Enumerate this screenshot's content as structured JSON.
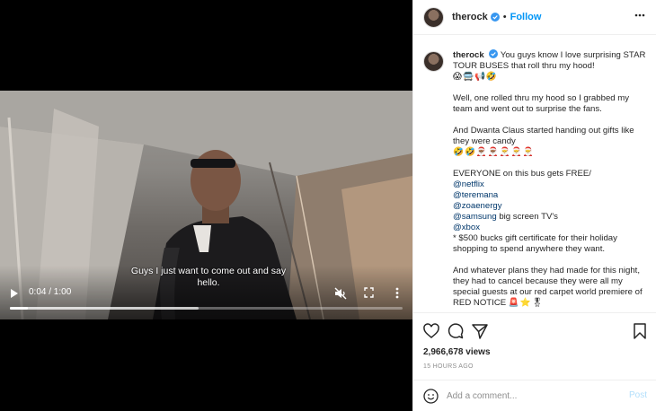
{
  "video": {
    "subtitle": "Guys I just want to come out and say hello.",
    "time": "0:04 / 1:00",
    "progress_played": 0.046,
    "progress_buffered": 0.48
  },
  "header": {
    "username": "therock",
    "separator": "•",
    "follow_label": "Follow"
  },
  "caption": {
    "username": "therock",
    "intro": "You guys know I love surprising STAR TOUR BUSES that roll thru my hood!",
    "intro_emojis": "😱🚍📢🤣",
    "p2": "Well, one rolled thru my hood so I grabbed my team and went out to surprise the fans.",
    "p3": "And Dwanta Claus started handing out gifts like they were candy",
    "p3_emojis": "🤣🤣🎅🏾🎅🏾🎅🎅🎅",
    "p4_lead": "EVERYONE on this bus gets FREE/",
    "mention_1": "@netflix",
    "mention_2": "@teremana",
    "mention_3": "@zoaenergy",
    "mention_4": "@samsung",
    "mention_4_text": " big screen TV's",
    "mention_5": "@xbox",
    "gift_line": "* $500 bucks gift certificate for their holiday shopping to spend anywhere they want.",
    "p5": "And whatever plans they had made for this night, they had to cancel because they were all my special guests at our red carpet world premiere of RED NOTICE",
    "p5_emojis": "🚨⭐🎖"
  },
  "stats": {
    "views": "2,966,678 views",
    "timestamp": "15 HOURS AGO"
  },
  "comment": {
    "placeholder": "Add a comment...",
    "post_label": "Post"
  },
  "colors": {
    "accent": "#0095f6",
    "verified": "#3897f0",
    "mention": "#00376b",
    "post_disabled": "#b2dffc"
  }
}
